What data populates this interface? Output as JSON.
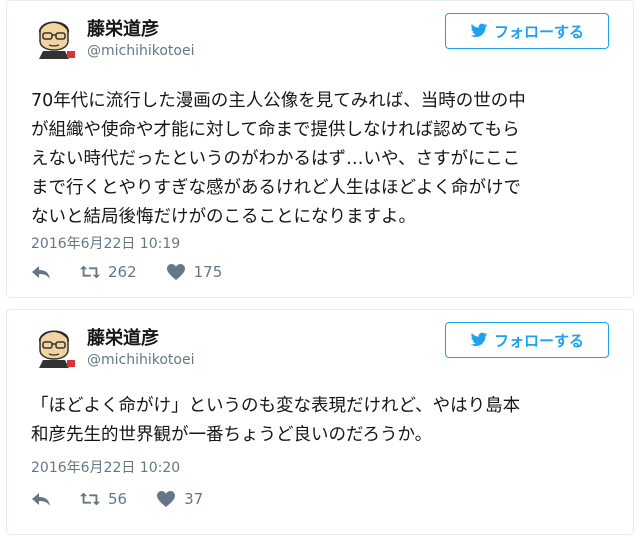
{
  "accent": "#1da1f2",
  "tweets": [
    {
      "author": {
        "name": "藤栄道彦",
        "handle": "@michihikotoei"
      },
      "follow_label": "フォローする",
      "lines": [
        "70年代に流行した漫画の主人公像を見てみれば、当時の世の中",
        "が組織や使命や才能に対して命まで提供しなければ認めてもら",
        "えない時代だったというのがわかるはず…いや、さすがにここ",
        "まで行くとやりすぎな感があるけれど人生はほどよく命がけで",
        "ないと結局後悔だけがのこることになりますよ。"
      ],
      "timestamp": "2016年6月22日 10:19",
      "retweets": "262",
      "likes": "175"
    },
    {
      "author": {
        "name": "藤栄道彦",
        "handle": "@michihikotoei"
      },
      "follow_label": "フォローする",
      "lines": [
        "「ほどよく命がけ」というのも変な表現だけれど、やはり島本",
        "和彦先生的世界観が一番ちょうど良いのだろうか。"
      ],
      "timestamp": "2016年6月22日 10:20",
      "retweets": "56",
      "likes": "37"
    }
  ],
  "icons": {
    "follow": "twitter-bird-icon",
    "reply": "reply-icon",
    "retweet": "retweet-icon",
    "like": "heart-icon"
  }
}
